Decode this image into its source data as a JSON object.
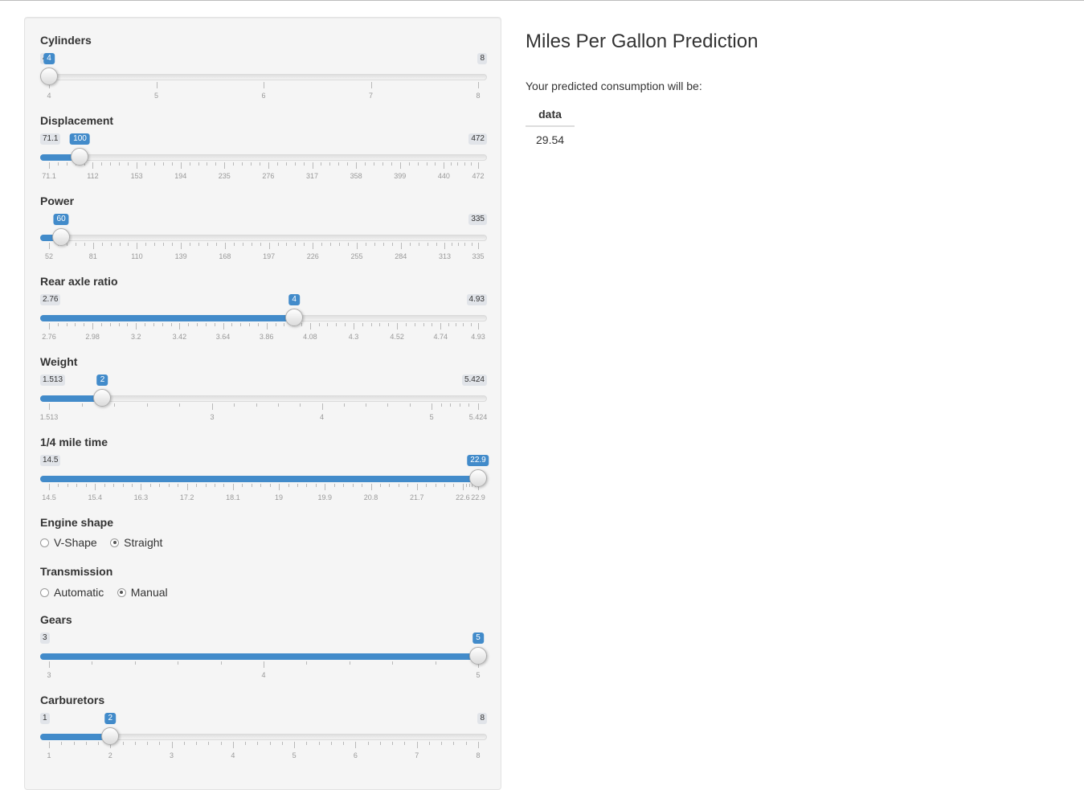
{
  "sidebar": {
    "sliders": [
      {
        "id": "cyl",
        "label": "Cylinders",
        "min": 4,
        "max": 8,
        "value": 4,
        "min_label": "4",
        "max_label": "8",
        "value_label": "4",
        "ticks": [
          "4",
          "5",
          "6",
          "7",
          "8"
        ],
        "minor_per_gap": 0
      },
      {
        "id": "disp",
        "label": "Displacement",
        "min": 71.1,
        "max": 472,
        "value": 100,
        "min_label": "71.1",
        "max_label": "472",
        "value_label": "100",
        "ticks": [
          "71.1",
          "112",
          "153",
          "194",
          "235",
          "276",
          "317",
          "358",
          "399",
          "440",
          "472"
        ],
        "minor_per_gap": 4
      },
      {
        "id": "hp",
        "label": "Power",
        "min": 52,
        "max": 335,
        "value": 60,
        "min_label": "",
        "max_label": "335",
        "value_label": "60",
        "ticks": [
          "52",
          "81",
          "110",
          "139",
          "168",
          "197",
          "226",
          "255",
          "284",
          "313",
          "335"
        ],
        "minor_per_gap": 4
      },
      {
        "id": "drat",
        "label": "Rear axle ratio",
        "min": 2.76,
        "max": 4.93,
        "value": 4,
        "min_label": "2.76",
        "max_label": "4.93",
        "value_label": "4",
        "ticks": [
          "2.76",
          "2.98",
          "3.2",
          "3.42",
          "3.64",
          "3.86",
          "4.08",
          "4.3",
          "4.52",
          "4.74",
          "4.93"
        ],
        "minor_per_gap": 4
      },
      {
        "id": "wt",
        "label": "Weight",
        "min": 1.513,
        "max": 5.424,
        "value": 2,
        "min_label": "1.513",
        "max_label": "5.424",
        "value_label": "2",
        "ticks": [
          "1.513",
          "3",
          "4",
          "5",
          "5.424"
        ],
        "tick_values": [
          1.513,
          3,
          4,
          5,
          5.424
        ],
        "minor_per_gap": 4
      },
      {
        "id": "qsec",
        "label": "1/4 mile time",
        "min": 14.5,
        "max": 22.9,
        "value": 22.9,
        "min_label": "14.5",
        "max_label": "",
        "value_label": "22.9",
        "ticks": [
          "14.5",
          "15.4",
          "16.3",
          "17.2",
          "18.1",
          "19",
          "19.9",
          "20.8",
          "21.7",
          "22.6",
          "22.9"
        ],
        "minor_per_gap": 4
      }
    ],
    "engine_shape": {
      "label": "Engine shape",
      "options": [
        {
          "text": "V-Shape",
          "checked": false
        },
        {
          "text": "Straight",
          "checked": true
        }
      ]
    },
    "transmission": {
      "label": "Transmission",
      "options": [
        {
          "text": "Automatic",
          "checked": false
        },
        {
          "text": "Manual",
          "checked": true
        }
      ]
    },
    "sliders2": [
      {
        "id": "gear",
        "label": "Gears",
        "min": 3,
        "max": 5,
        "value": 5,
        "min_label": "3",
        "max_label": "",
        "value_label": "5",
        "ticks": [
          "3",
          "4",
          "5"
        ],
        "minor_per_gap": 4
      },
      {
        "id": "carb",
        "label": "Carburetors",
        "min": 1,
        "max": 8,
        "value": 2,
        "min_label": "1",
        "max_label": "8",
        "value_label": "2",
        "ticks": [
          "1",
          "2",
          "3",
          "4",
          "5",
          "6",
          "7",
          "8"
        ],
        "minor_per_gap": 4
      }
    ]
  },
  "main": {
    "title": "Miles Per Gallon Prediction",
    "subtitle": "Your predicted consumption will be:",
    "table_header": "data",
    "table_value": "29.54"
  },
  "colors": {
    "accent": "#428bca",
    "track": "#e6e6e6",
    "panel": "#f5f5f5"
  }
}
